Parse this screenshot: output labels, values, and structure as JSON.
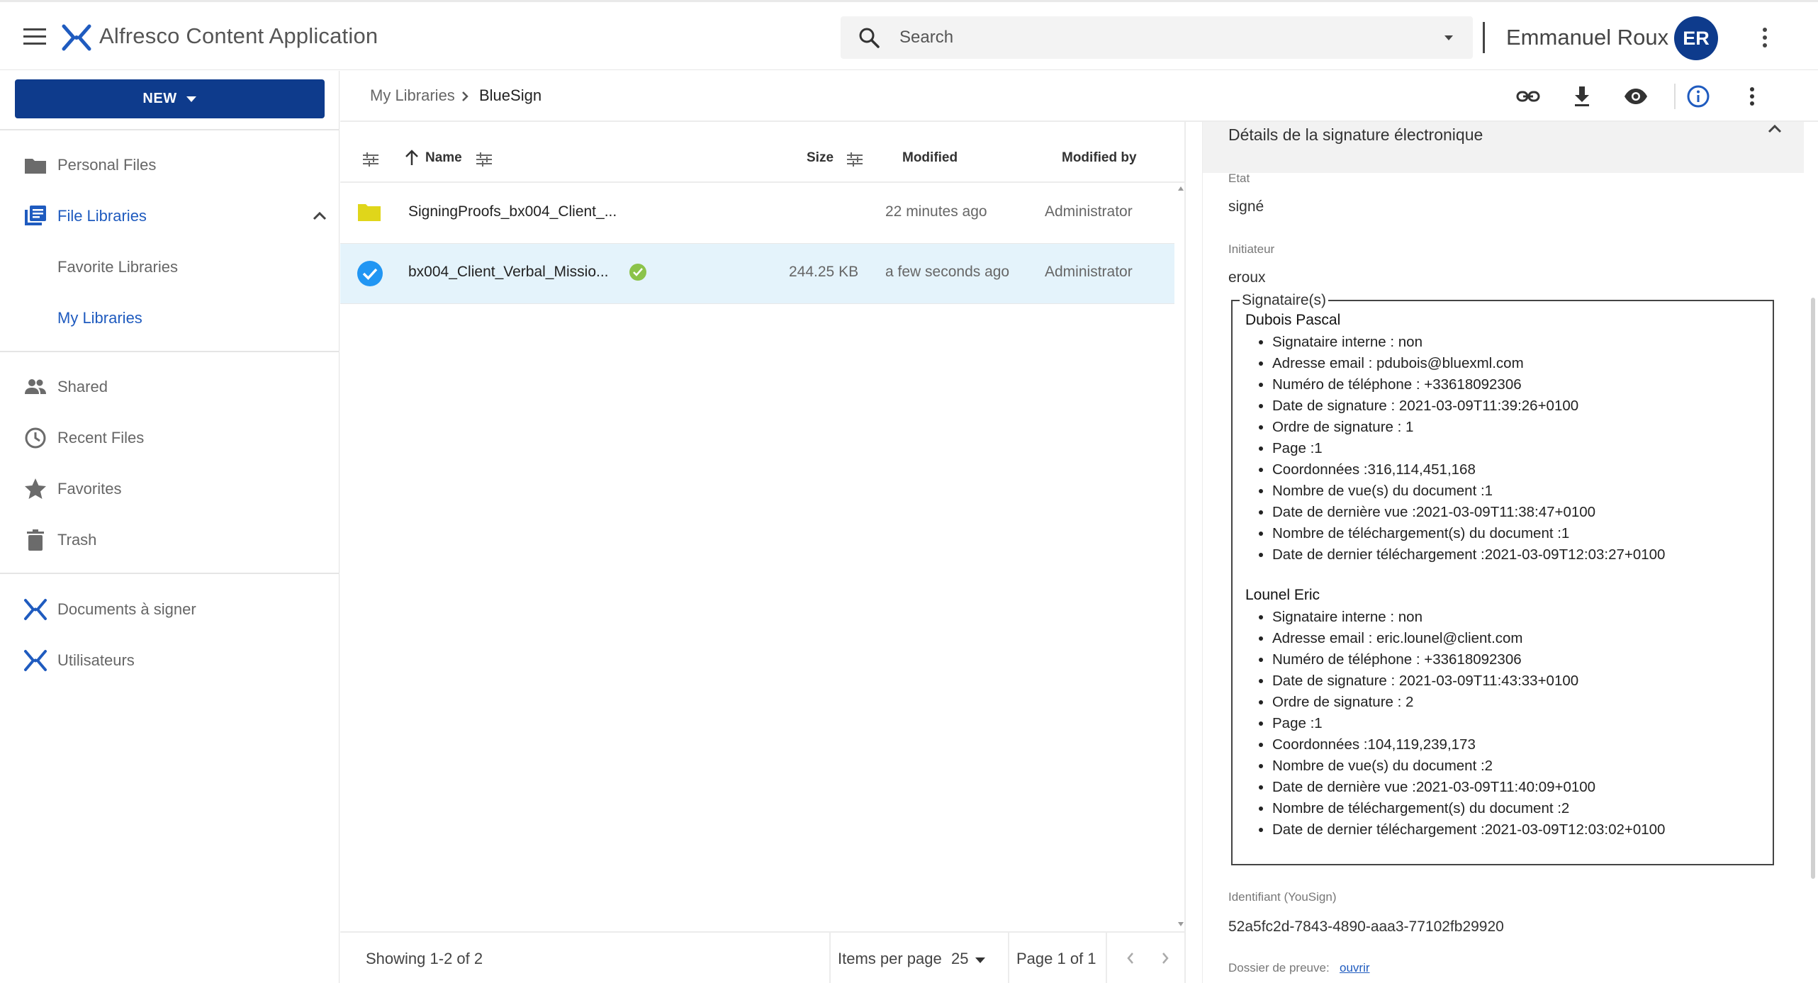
{
  "header": {
    "app_title": "Alfresco Content Application",
    "search_placeholder": "Search",
    "user_name": "Emmanuel Roux",
    "user_initials": "ER",
    "brand_color": "#0e3b8c"
  },
  "sidebar": {
    "new_label": "NEW",
    "items": [
      {
        "label": "Personal Files",
        "icon": "folder-icon"
      },
      {
        "label": "File Libraries",
        "icon": "library-icon",
        "active": true
      },
      {
        "label": "Favorite Libraries"
      },
      {
        "label": "My Libraries",
        "active": true
      },
      {
        "label": "Shared",
        "icon": "people-icon"
      },
      {
        "label": "Recent Files",
        "icon": "clock-icon"
      },
      {
        "label": "Favorites",
        "icon": "star-icon"
      },
      {
        "label": "Trash",
        "icon": "trash-icon"
      },
      {
        "label": "Documents à signer",
        "icon": "alfresco-logo-icon"
      },
      {
        "label": "Utilisateurs",
        "icon": "alfresco-logo-icon"
      }
    ]
  },
  "breadcrumb": {
    "root": "My Libraries",
    "current": "BlueSign"
  },
  "file_list": {
    "columns": {
      "name": "Name",
      "size": "Size",
      "modified": "Modified",
      "modified_by": "Modified by"
    },
    "rows": [
      {
        "name": "SigningProofs_bx004_Client_...",
        "size": "",
        "modified": "22 minutes ago",
        "modified_by": "Administrator",
        "type": "folder",
        "selected": false
      },
      {
        "name": "bx004_Client_Verbal_Missio...",
        "size": "244.25 KB",
        "modified": "a few seconds ago",
        "modified_by": "Administrator",
        "type": "file",
        "selected": true
      }
    ],
    "footer": {
      "showing": "Showing 1-2 of 2",
      "items_per_page_label": "Items per page",
      "items_per_page_value": "25",
      "page_info": "Page 1 of 1"
    }
  },
  "details": {
    "title": "Détails de la signature électronique",
    "etat_label": "Etat",
    "etat_value": "signé",
    "initiateur_label": "Initiateur",
    "initiateur_value": "eroux",
    "signers_legend": "Signataire(s)",
    "signers": [
      {
        "name": "Dubois Pascal",
        "lines": [
          "Signataire interne : non",
          "Adresse email : pdubois@bluexml.com",
          "Numéro de téléphone : +33618092306",
          "Date de signature : 2021-03-09T11:39:26+0100",
          "Ordre de signature : 1",
          "Page :1",
          "Coordonnées :316,114,451,168",
          "Nombre de vue(s) du document :1",
          "Date de dernière vue :2021-03-09T11:38:47+0100",
          "Nombre de téléchargement(s) du document :1",
          "Date de dernier téléchargement :2021-03-09T12:03:27+0100"
        ]
      },
      {
        "name": "Lounel Eric",
        "lines": [
          "Signataire interne : non",
          "Adresse email : eric.lounel@client.com",
          "Numéro de téléphone : +33618092306",
          "Date de signature : 2021-03-09T11:43:33+0100",
          "Ordre de signature : 2",
          "Page :1",
          "Coordonnées :104,119,239,173",
          "Nombre de vue(s) du document :2",
          "Date de dernière vue :2021-03-09T11:40:09+0100",
          "Nombre de téléchargement(s) du document :2",
          "Date de dernier téléchargement :2021-03-09T12:03:02+0100"
        ]
      }
    ],
    "identifiant_label": "Identifiant (YouSign)",
    "identifiant_value": "52a5fc2d-7843-4890-aaa3-77102fb29920",
    "dossier_label": "Dossier de preuve:",
    "dossier_link": "ouvrir"
  }
}
